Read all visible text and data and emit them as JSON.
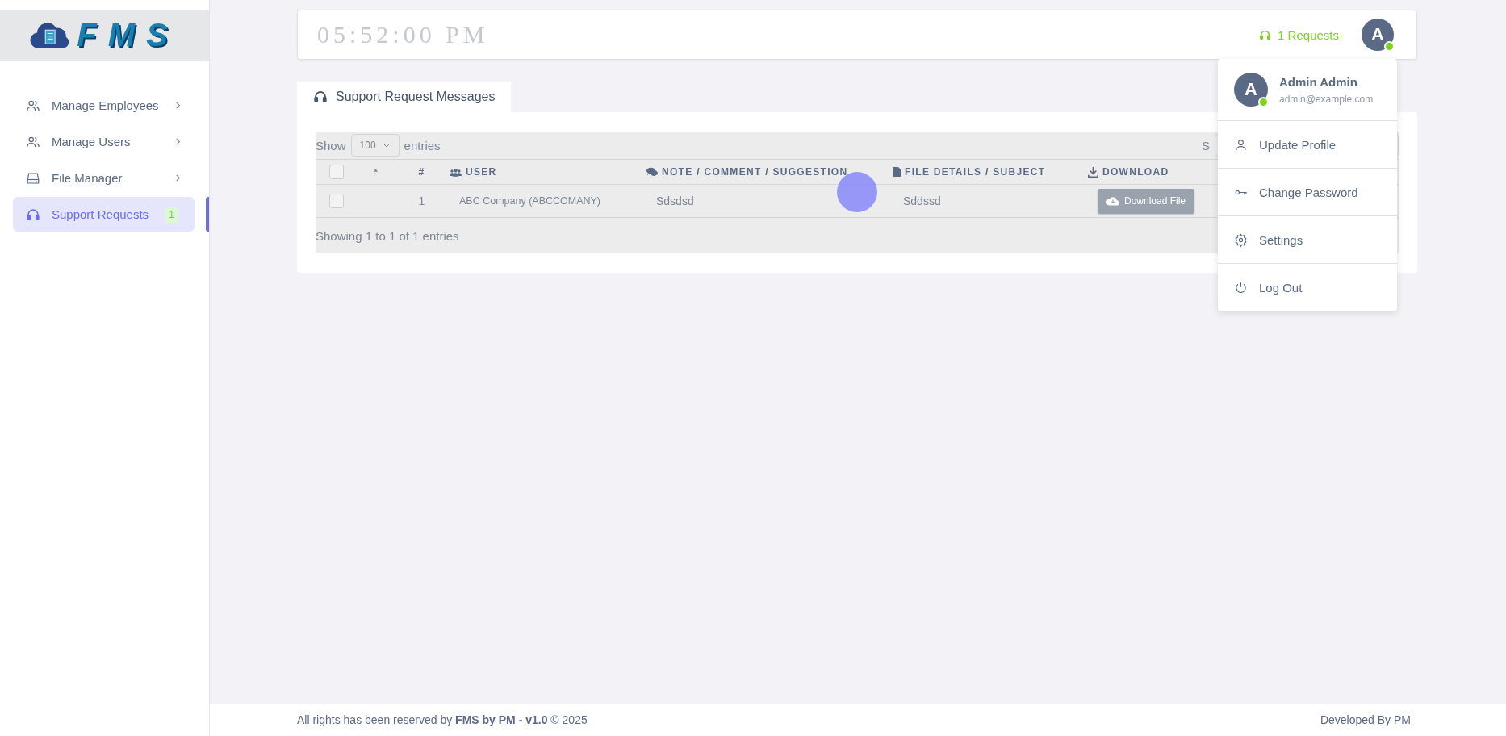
{
  "logo": {
    "text": "FMS"
  },
  "sidebar": {
    "items": [
      {
        "label": "Manage Employees",
        "kind": "submenu",
        "selected": false
      },
      {
        "label": "Manage Users",
        "kind": "submenu",
        "selected": false
      },
      {
        "label": "File Manager",
        "kind": "submenu",
        "selected": false
      },
      {
        "label": "Support Requests",
        "kind": "link",
        "selected": true,
        "badge": "1"
      }
    ]
  },
  "header": {
    "clock": "05:52:00 PM",
    "requests": "1 Requests",
    "avatar": "A",
    "online": true
  },
  "user_menu": {
    "name": "Admin Admin",
    "email": "admin@example.com",
    "avatar": "A",
    "online": true,
    "items": [
      {
        "label": "Update Profile"
      },
      {
        "label": "Change Password"
      },
      {
        "label": "Settings"
      },
      {
        "label": "Log Out"
      }
    ]
  },
  "tab": {
    "label": "Support Request Messages",
    "selected": true
  },
  "table": {
    "select_all": false,
    "show_label": "Show",
    "page_size": "100",
    "entries_label": "entries",
    "search_label": "S",
    "columns": [
      {
        "label": "#"
      },
      {
        "label": "USER"
      },
      {
        "label": "NOTE / COMMENT / SUGGESTION"
      },
      {
        "label": "FILE DETAILS / SUBJECT"
      },
      {
        "label": "DOWNLOAD"
      }
    ],
    "rows": [
      {
        "checked": false,
        "number": "1",
        "user": "ABC Company (ABCCOMANY)",
        "note": "Sdsdsd",
        "subject": "Sddssd",
        "action": "Download File"
      }
    ],
    "info": "Showing 1 to 1 of 1 entries"
  },
  "footer": {
    "left": "All rights has been reserved by **FMS by PM - v1.0** © 2025",
    "right": "Developed By PM"
  }
}
